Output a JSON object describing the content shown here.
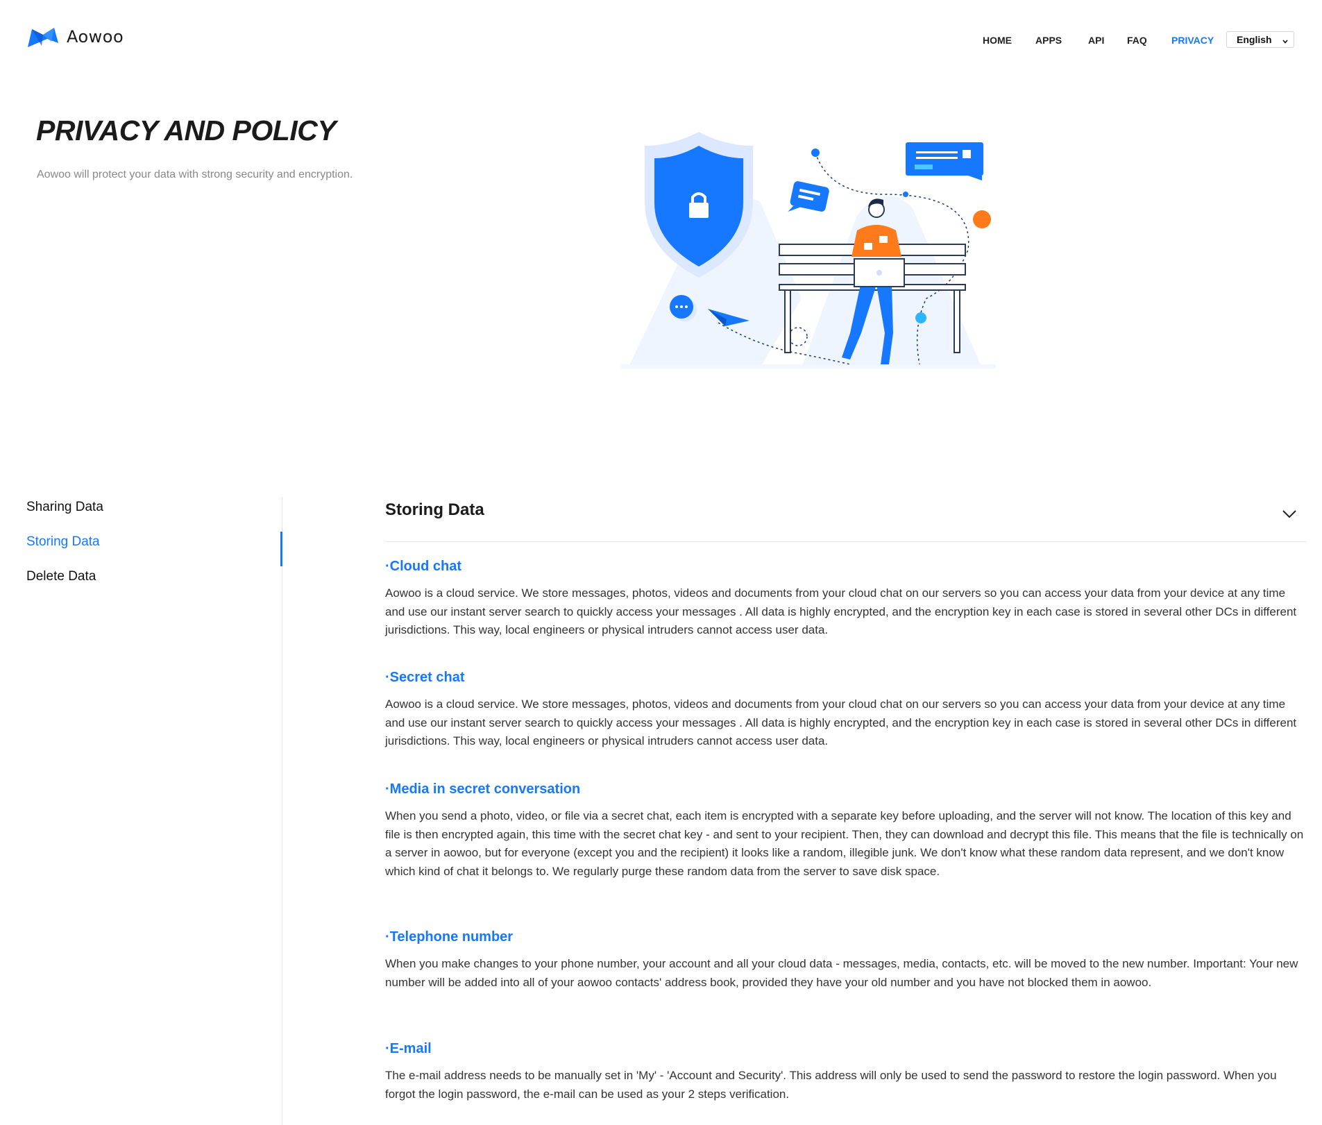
{
  "brand": {
    "name": "Aowoo",
    "accent": "#1677ff",
    "logo_icon": "aowoo-logo-icon"
  },
  "nav": {
    "items": [
      {
        "label": "HOME",
        "active": false
      },
      {
        "label": "APPS",
        "active": false
      },
      {
        "label": "API",
        "active": false
      },
      {
        "label": "FAQ",
        "active": false
      },
      {
        "label": "PRIVACY",
        "active": true
      }
    ],
    "language": {
      "selected": "English"
    }
  },
  "hero": {
    "title": "PRIVACY AND POLICY",
    "subtitle": "Aowoo will protect your data with strong security and encryption.",
    "illustration": "security-illustration"
  },
  "sidebar": {
    "items": [
      {
        "label": "Sharing Data",
        "active": false
      },
      {
        "label": "Storing Data",
        "active": true
      },
      {
        "label": "Delete Data",
        "active": false
      }
    ]
  },
  "section": {
    "title": "Storing Data",
    "toggle_icon": "chevron-down-icon",
    "topics": [
      {
        "title": "·Cloud chat",
        "body": "Aowoo is a cloud service. We store messages, photos, videos and documents from your cloud chat on our servers so you can access your data from your device at any time and use our instant server search to quickly access your messages . All data is highly encrypted, and the encryption key in each case is stored in several other DCs in different jurisdictions. This way, local engineers or physical intruders cannot access user data."
      },
      {
        "title": "·Secret chat",
        "body": "Aowoo is a cloud service. We store messages, photos, videos and documents from your cloud chat on our servers so you can access your data from your device at any time and use our instant server search to quickly access your messages . All data is highly encrypted, and the encryption key in each case is stored in several other DCs in different jurisdictions. This way, local engineers or physical intruders cannot access user data."
      },
      {
        "title": "·Media in secret conversation",
        "body": "When you send a photo, video, or file via a secret chat, each item is encrypted with a separate key before uploading, and the server will not know. The location of this key and file is then encrypted again, this time with the secret chat key - and sent to your recipient. Then, they can download and decrypt this file. This means that the file is technically on a server in aowoo, but for everyone (except you and the recipient) it looks like a random, illegible junk. We don't know what these random data represent, and we don't know which kind of chat it belongs to. We regularly purge these random data from the server to save disk space."
      },
      {
        "title": "·Telephone number",
        "body": "When you make changes to your phone number, your account and all your cloud data - messages, media, contacts, etc. will be moved to the new number. Important: Your new number will be added into all of your aowoo contacts' address book, provided they have your old number and you have not blocked them in aowoo."
      },
      {
        "title": "·E-mail",
        "body": "The e-mail address needs to be manually set in 'My' - 'Account and Security'. This address will only be used to send the password to restore the login password. When you forgot the login password, the e-mail can be used as your 2 steps verification."
      }
    ]
  }
}
